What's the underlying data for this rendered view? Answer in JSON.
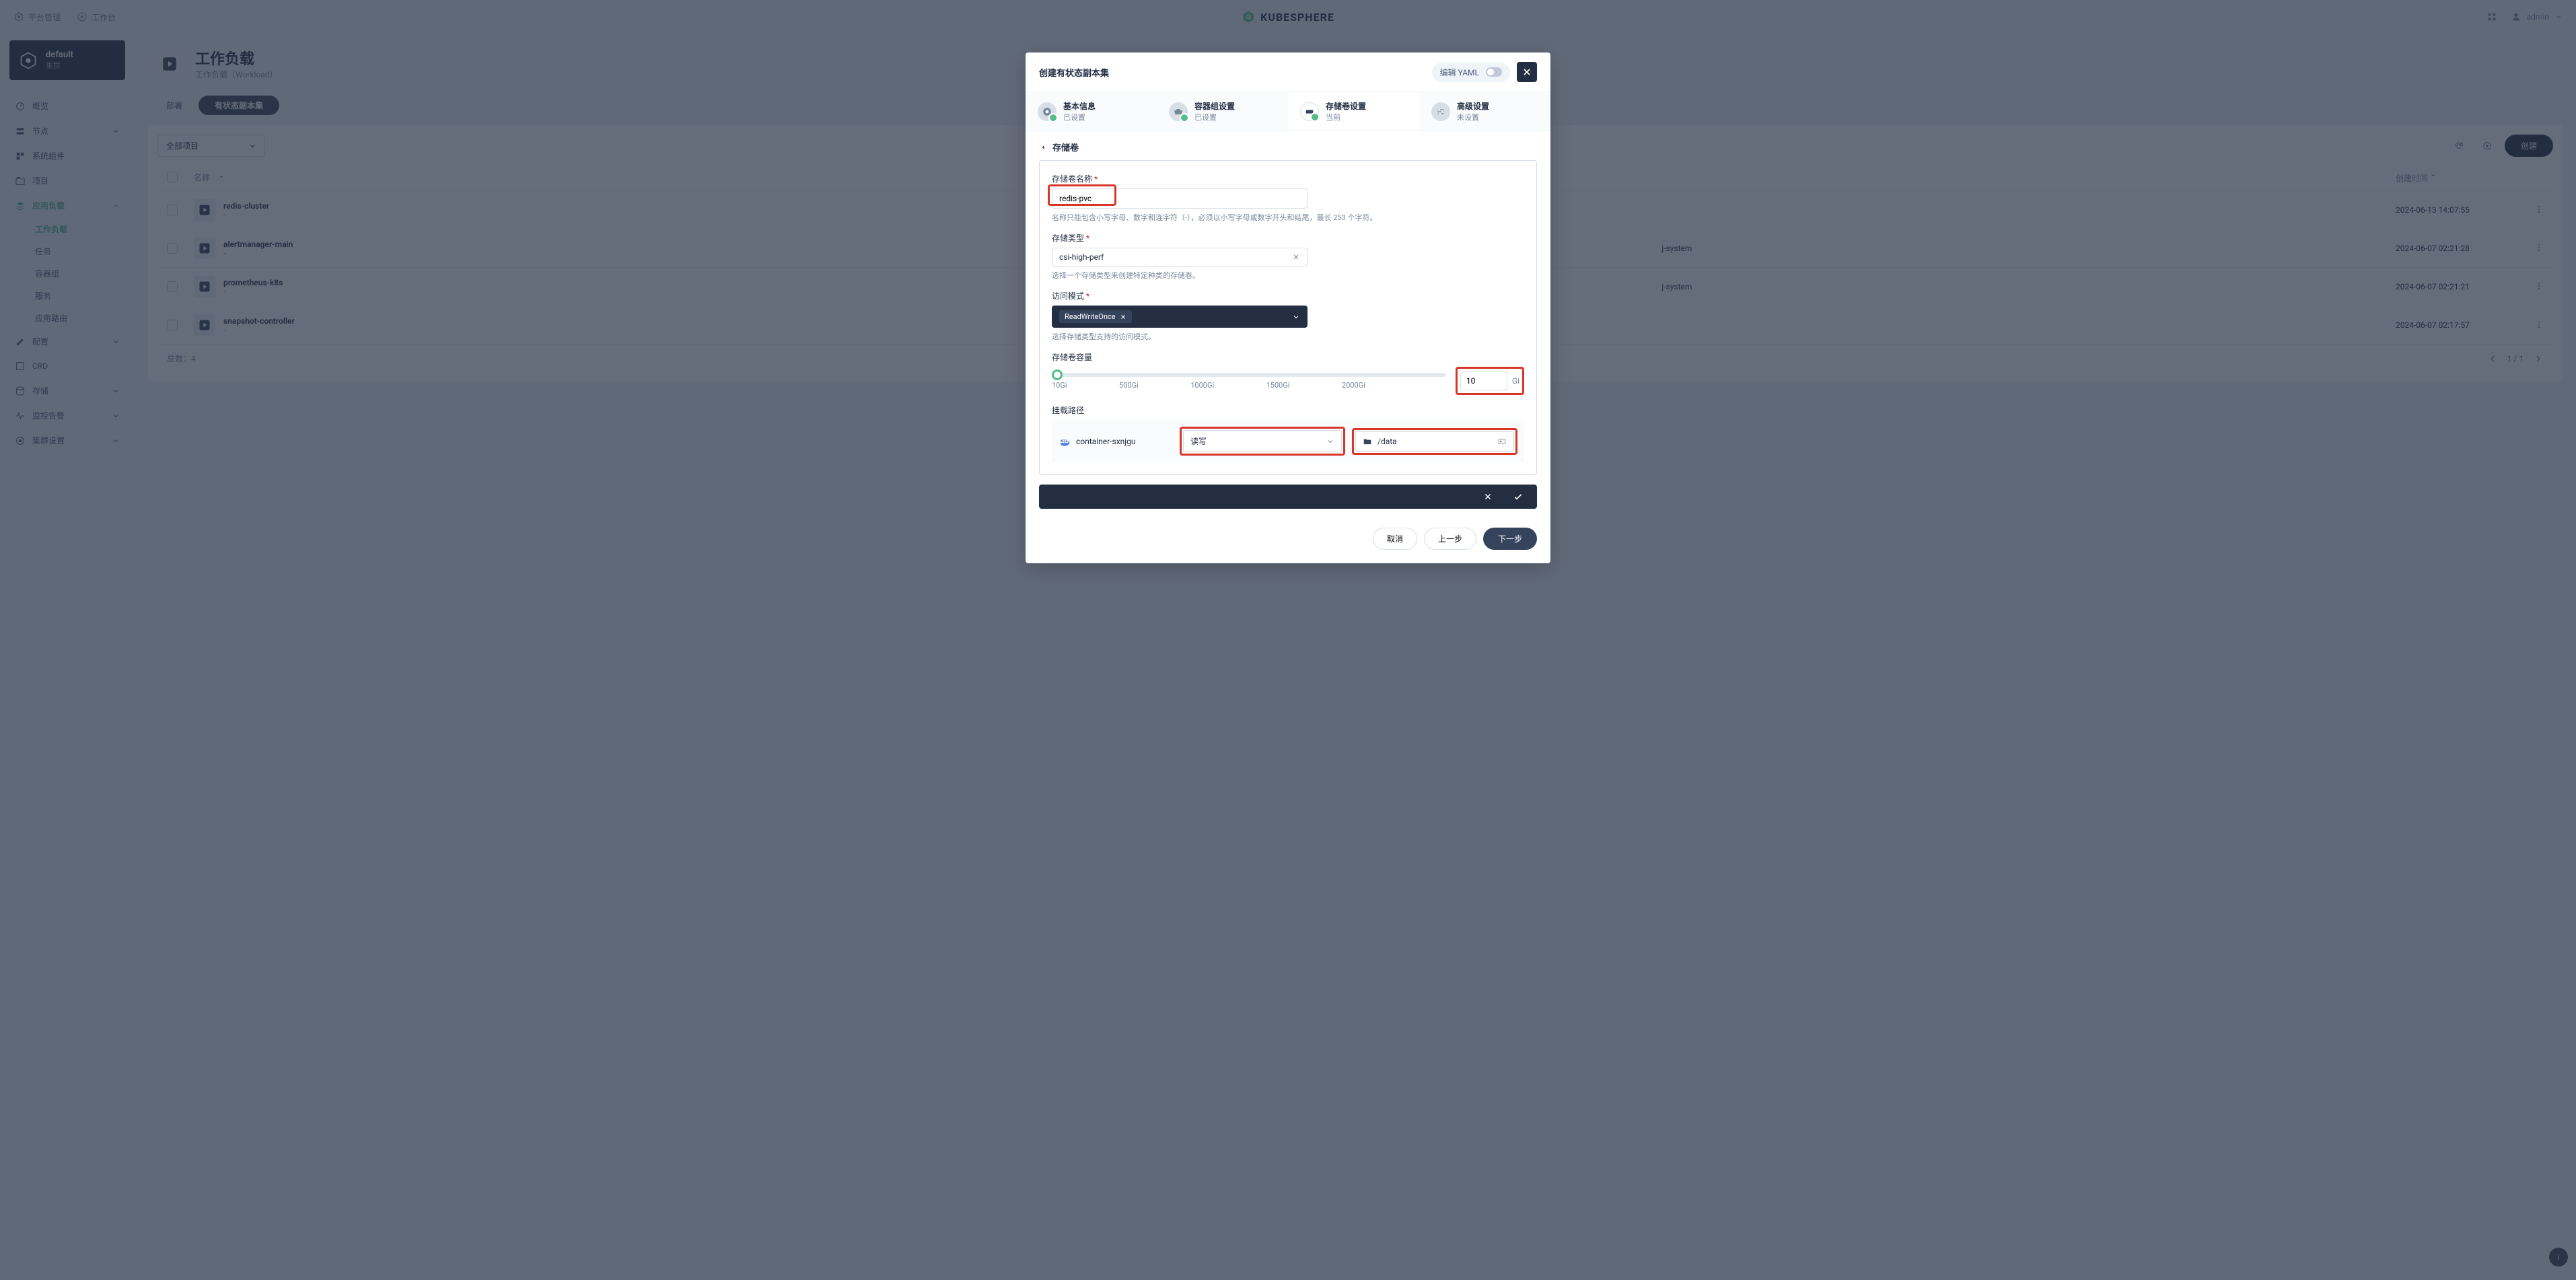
{
  "topbar": {
    "platform": "平台管理",
    "workbench": "工作台",
    "brand": "KUBESPHERE",
    "user": "admin"
  },
  "cluster": {
    "name": "default",
    "label": "集群"
  },
  "nav": {
    "overview": "概览",
    "nodes": "节点",
    "components": "系统组件",
    "projects": "项目",
    "workloads": "应用负载",
    "sub": {
      "workload": "工作负载",
      "jobs": "任务",
      "pods": "容器组",
      "services": "服务",
      "routes": "应用路由"
    },
    "config": "配置",
    "crd": "CRD",
    "storage": "存储",
    "monitoring": "监控告警",
    "clusterSettings": "集群设置"
  },
  "page": {
    "title": "工作负载",
    "sub": "工作负载（Workload）",
    "tabs": {
      "deploy": "部署",
      "stateful": "有状态副本集"
    },
    "projectFilter": "全部项目",
    "createBtn": "创建",
    "total": "总数：4",
    "pageInfo": "1 / 1",
    "columns": {
      "name": "名称",
      "time": "创建时间"
    },
    "rows": [
      {
        "name": "redis-cluster",
        "sub": "-",
        "ns": "",
        "time": "2024-06-13 14:07:55"
      },
      {
        "name": "alertmanager-main",
        "sub": "-",
        "ns": "j-system",
        "time": "2024-06-07 02:21:28"
      },
      {
        "name": "prometheus-k8s",
        "sub": "-",
        "ns": "j-system",
        "time": "2024-06-07 02:21:21"
      },
      {
        "name": "snapshot-controller",
        "sub": "-",
        "ns": "",
        "time": "2024-06-07 02:17:57"
      }
    ]
  },
  "modal": {
    "title": "创建有状态副本集",
    "yaml": "编辑 YAML",
    "steps": {
      "basic": {
        "t": "基本信息",
        "s": "已设置"
      },
      "pod": {
        "t": "容器组设置",
        "s": "已设置"
      },
      "vol": {
        "t": "存储卷设置",
        "s": "当前"
      },
      "adv": {
        "t": "高级设置",
        "s": "未设置"
      }
    },
    "section": "存储卷",
    "form": {
      "nameLabel": "存储卷名称",
      "nameValue": "redis-pvc",
      "nameHelp": "名称只能包含小写字母、数字和连字符（-），必须以小写字母或数字开头和结尾，最长 253 个字符。",
      "typeLabel": "存储类型",
      "typeValue": "csi-high-perf",
      "typeHelp": "选择一个存储类型来创建特定种类的存储卷。",
      "modeLabel": "访问模式",
      "modeValue": "ReadWriteOnce",
      "modeHelp": "选择存储类型支持的访问模式。",
      "capLabel": "存储卷容量",
      "capValue": "10",
      "capUnit": "Gi",
      "ticks": [
        "10Gi",
        "500Gi",
        "1000Gi",
        "1500Gi",
        "2000Gi"
      ],
      "mountLabel": "挂载路径",
      "containerName": "container-sxnjgu",
      "mountMode": "读写",
      "mountPath": "/data"
    },
    "footer": {
      "cancel": "取消",
      "prev": "上一步",
      "next": "下一步"
    }
  }
}
